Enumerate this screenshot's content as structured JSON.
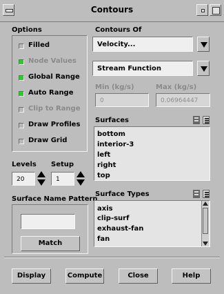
{
  "window": {
    "title": "Contours"
  },
  "options": {
    "heading": "Options",
    "items": [
      {
        "label": "Filled",
        "checked": false,
        "enabled": true
      },
      {
        "label": "Node Values",
        "checked": true,
        "enabled": false
      },
      {
        "label": "Global Range",
        "checked": true,
        "enabled": true
      },
      {
        "label": "Auto Range",
        "checked": true,
        "enabled": true
      },
      {
        "label": "Clip to Range",
        "checked": false,
        "enabled": false
      },
      {
        "label": "Draw Profiles",
        "checked": false,
        "enabled": true
      },
      {
        "label": "Draw Grid",
        "checked": false,
        "enabled": true
      }
    ]
  },
  "contours_of": {
    "heading": "Contours Of",
    "category": "Velocity...",
    "quantity": "Stream Function"
  },
  "range": {
    "min_label": "Min (kg/s)",
    "max_label": "Max (kg/s)",
    "min_value": "0",
    "max_value": "0.06964447"
  },
  "surfaces": {
    "heading": "Surfaces",
    "items": [
      "bottom",
      "interior-3",
      "left",
      "right",
      "top"
    ]
  },
  "levels": {
    "label": "Levels",
    "value": "20"
  },
  "setup": {
    "label": "Setup",
    "value": "1"
  },
  "surface_name_pattern": {
    "label": "Surface Name Pattern",
    "match_label": "Match",
    "value": ""
  },
  "surface_types": {
    "heading": "Surface Types",
    "items": [
      "axis",
      "clip-surf",
      "exhaust-fan",
      "fan"
    ]
  },
  "buttons": {
    "display": "Display",
    "compute": "Compute",
    "close": "Close",
    "help": "Help"
  },
  "colors": {
    "checked": "#21d321",
    "background": "#bdbdbd"
  }
}
